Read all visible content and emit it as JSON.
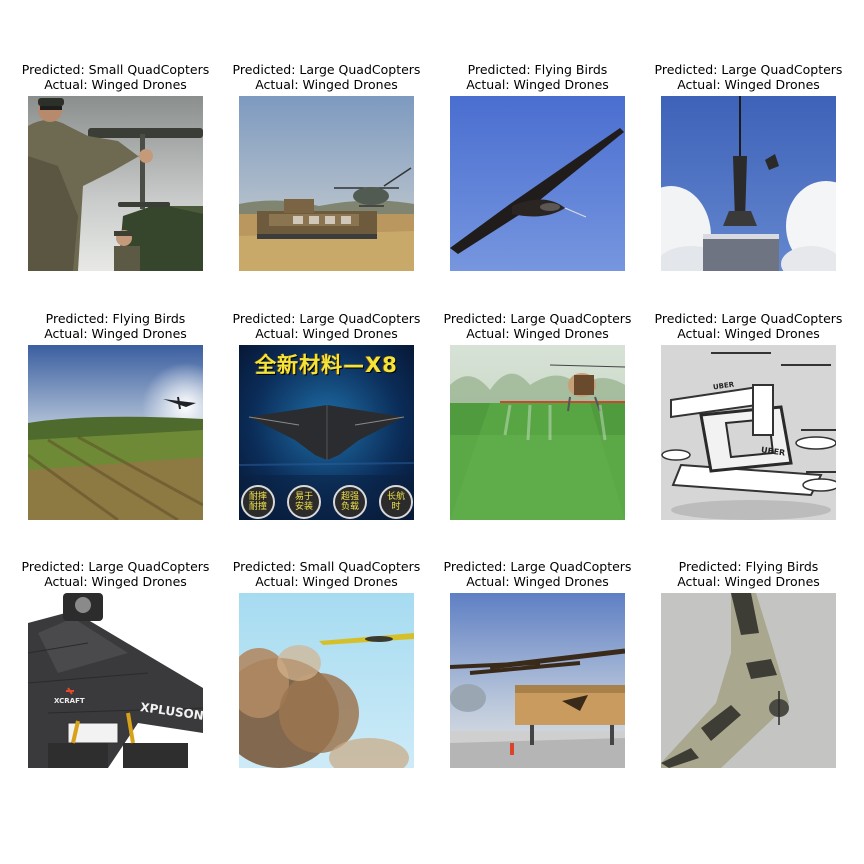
{
  "predicted_prefix": "Predicted: ",
  "actual_prefix": "Actual: ",
  "panels": [
    {
      "predicted": "Predicted: Small QuadCopters",
      "actual": "Actual: Winged Drones"
    },
    {
      "predicted": "Predicted: Large QuadCopters",
      "actual": "Actual: Winged Drones"
    },
    {
      "predicted": "Predicted: Flying Birds",
      "actual": "Actual: Winged Drones"
    },
    {
      "predicted": "Predicted: Large QuadCopters",
      "actual": "Actual: Winged Drones"
    },
    {
      "predicted": "Predicted: Flying Birds",
      "actual": "Actual: Winged Drones"
    },
    {
      "predicted": "Predicted: Large QuadCopters",
      "actual": "Actual: Winged Drones"
    },
    {
      "predicted": "Predicted: Large QuadCopters",
      "actual": "Actual: Winged Drones"
    },
    {
      "predicted": "Predicted: Large QuadCopters",
      "actual": "Actual: Winged Drones"
    },
    {
      "predicted": "Predicted: Large QuadCopters",
      "actual": "Actual: Winged Drones"
    },
    {
      "predicted": "Predicted: Small QuadCopters",
      "actual": "Actual: Winged Drones"
    },
    {
      "predicted": "Predicted: Large QuadCopters",
      "actual": "Actual: Winged Drones"
    },
    {
      "predicted": "Predicted: Flying Birds",
      "actual": "Actual: Winged Drones"
    }
  ],
  "image_text": {
    "panel6_title": "全新材料—X8",
    "panel6_badges": [
      "耐摔耐撞",
      "易于安装",
      "超强负载",
      "长航时"
    ],
    "panel8_logo": "UBER",
    "panel9_brand": "XCRAFT",
    "panel9_model": "XPLUSONE"
  },
  "colors": {
    "sky_blue": "#5b86d6",
    "grass_green": "#4e9a3a",
    "background": "#ffffff"
  }
}
